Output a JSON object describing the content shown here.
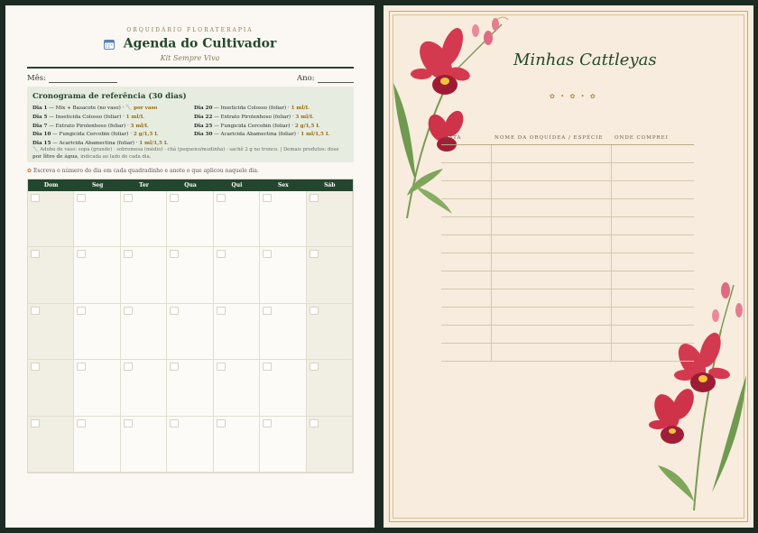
{
  "left_page": {
    "brand": "ORQUIDÁRIO FLORATERAPIA",
    "title": "Agenda do Cultivador",
    "subtitle": "Kit Sempre Viva",
    "month_label": "Mês:",
    "year_label": "Ano:",
    "reference": {
      "title": "Cronograma de referência (30 dias)",
      "col1": [
        {
          "day": "Dia 1",
          "text": " — Mix + Basacote (no vaso) · ",
          "dose": "🥄 por vaso"
        },
        {
          "day": "Dia 5",
          "text": " — Inseticida Colosso (foliar) · ",
          "dose": "1 ml/L"
        },
        {
          "day": "Dia 7",
          "text": " — Extrato Pirolenhoso (foliar) · ",
          "dose": "3 ml/L"
        },
        {
          "day": "Dia 10",
          "text": " — Fungicida Cercobin (foliar) · ",
          "dose": "2 g/1,5 L"
        },
        {
          "day": "Dia 15",
          "text": " — Acaricida Abamectina (foliar) · ",
          "dose": "1 ml/1,5 L"
        }
      ],
      "col2": [
        {
          "day": "Dia 20",
          "text": " — Inseticida Colosso (foliar) · ",
          "dose": "1 ml/L"
        },
        {
          "day": "Dia 22",
          "text": " — Extrato Pirolenhoso (foliar) · ",
          "dose": "3 ml/L"
        },
        {
          "day": "Dia 25",
          "text": " — Fungicida Cercobin (foliar) · ",
          "dose": "2 g/1,5 L"
        },
        {
          "day": "Dia 30",
          "text": " — Acaricida Abamectina (foliar) · ",
          "dose": "1 ml/1,5 L"
        }
      ],
      "note_a": "🥄 Adubo de vaso: sopa (grande) · sobremesa (médio) · chá (pequeno/mudinha) · sachê 2 g no tronco.  |  Demais produtos: dose ",
      "note_b": "por litro de água",
      "note_c": ", indicada ao lado de cada dia."
    },
    "instruction": "Escreva o número do dia em cada quadradinho e anote o que aplicou naquele dia.",
    "weekdays": [
      "Dom",
      "Seg",
      "Ter",
      "Qua",
      "Qui",
      "Sex",
      "Sáb"
    ]
  },
  "right_page": {
    "title": "Minhas Cattleyas",
    "ornament": "✿ • ✿ • ✿",
    "columns": [
      "DATA",
      "NOME DA ORQUÍDEA / ESPÉCIE",
      "ONDE COMPREI"
    ],
    "row_count": 12
  },
  "colors": {
    "accent_green": "#23472e",
    "gold": "#b08a3a",
    "orchid": "#c8334a"
  }
}
